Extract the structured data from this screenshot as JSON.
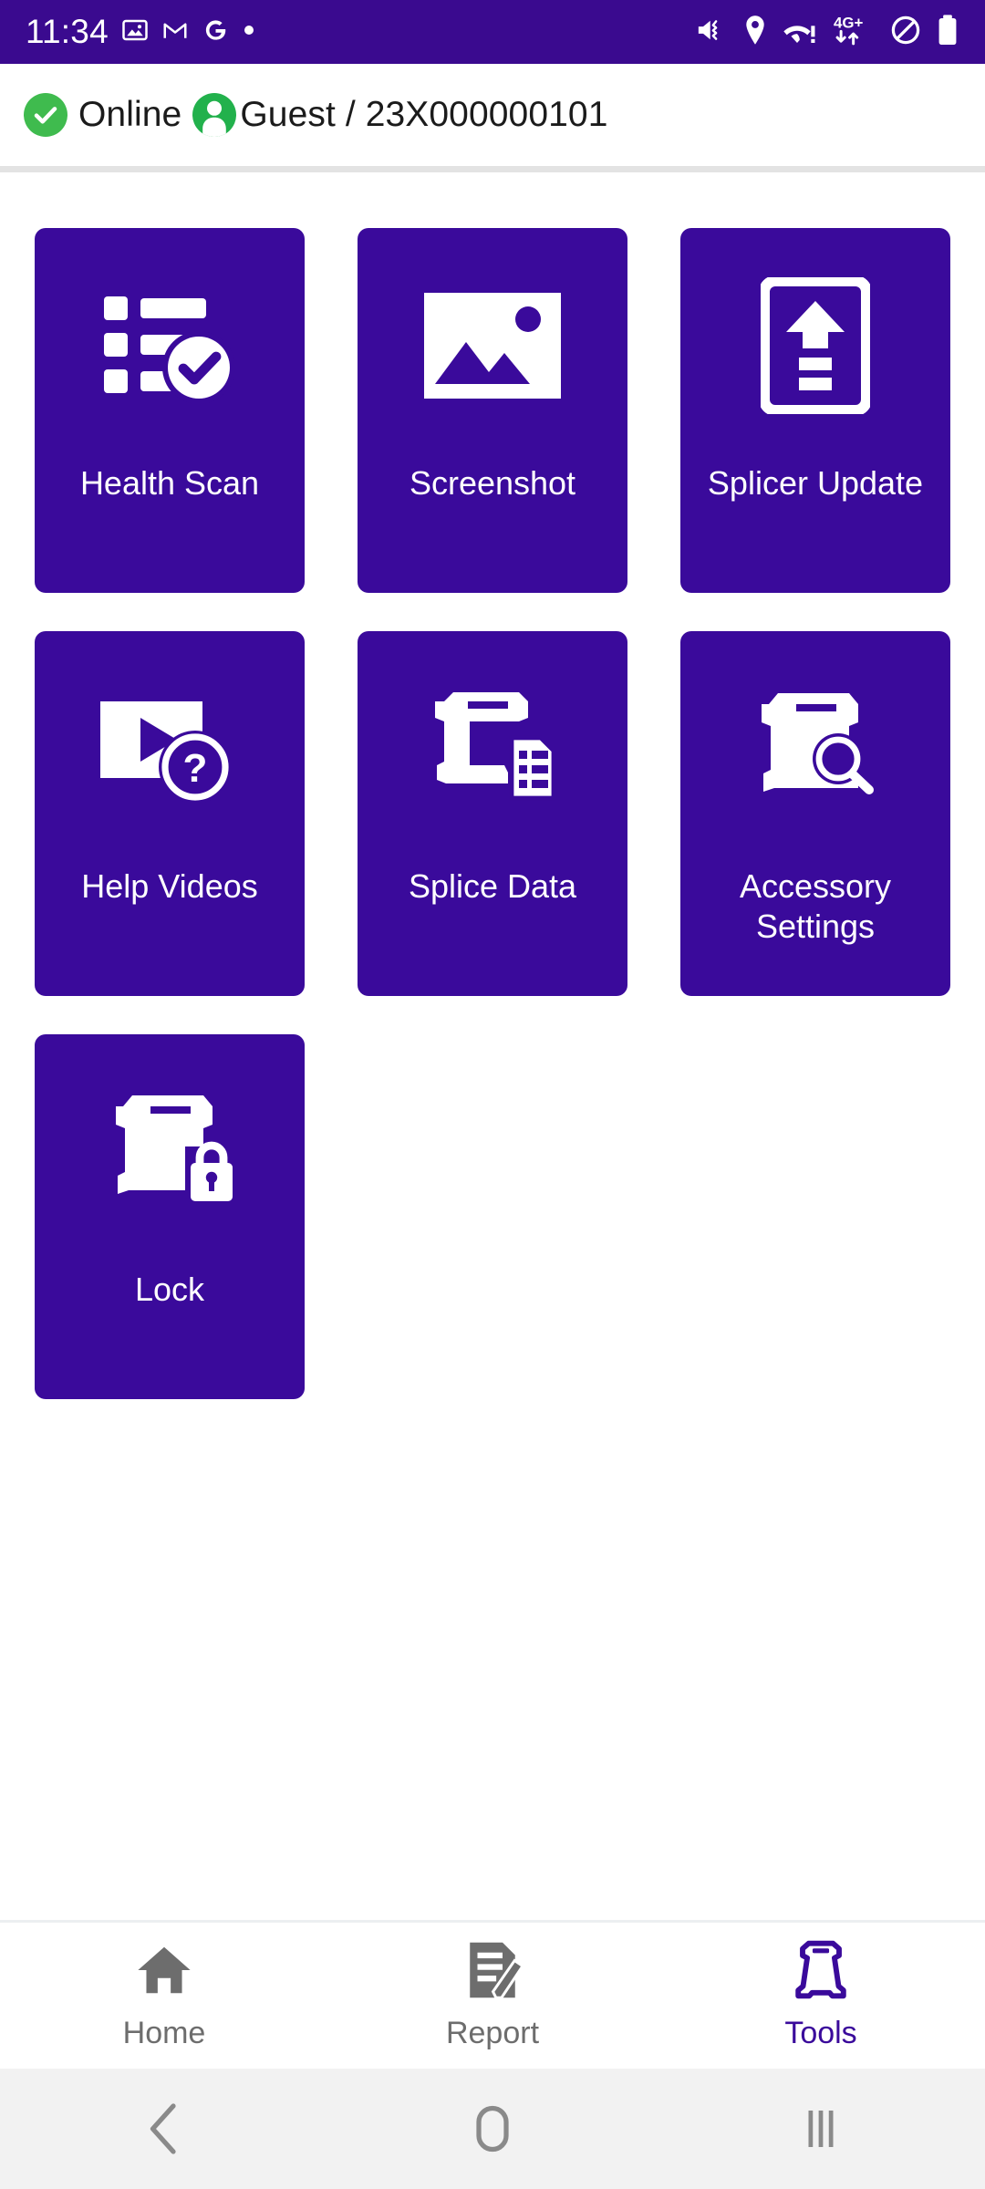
{
  "statusbar": {
    "time": "11:34",
    "left_icons": [
      "photos-icon",
      "gmail-icon",
      "google-icon",
      "dot-icon"
    ],
    "right_icons": [
      "mute-vibrate-icon",
      "location-icon",
      "wifi-warning-icon",
      "network-4g-plus-icon",
      "do-not-disturb-icon",
      "battery-icon"
    ],
    "network_label": "4G+",
    "background_color": "#3a0a8f"
  },
  "header": {
    "status_text": "Online",
    "account_text": "Guest / 23X000000101",
    "status_icon": "check-circle-icon",
    "account_icon": "person-icon",
    "status_color": "#3fbb4e"
  },
  "theme": {
    "tile_purple": "#3a0a9b",
    "accent": "#3a0a9b",
    "inactive_gray": "#6d6d6d"
  },
  "tiles": [
    {
      "label": "Health Scan",
      "icon": "checklist-check-icon"
    },
    {
      "label": "Screenshot",
      "icon": "image-photo-icon"
    },
    {
      "label": "Splicer Update",
      "icon": "document-upload-icon"
    },
    {
      "label": "Help Videos",
      "icon": "video-question-icon"
    },
    {
      "label": "Splice Data",
      "icon": "splicer-document-icon"
    },
    {
      "label": "Accessory Settings",
      "icon": "splicer-search-icon"
    },
    {
      "label": "Lock",
      "icon": "splicer-lock-icon"
    }
  ],
  "bottom_nav": {
    "items": [
      {
        "label": "Home",
        "icon": "home-icon",
        "active": false
      },
      {
        "label": "Report",
        "icon": "report-icon",
        "active": false
      },
      {
        "label": "Tools",
        "icon": "tools-icon",
        "active": true
      }
    ]
  },
  "system_nav": {
    "back": "back-icon",
    "home": "home-circle-icon",
    "recents": "recents-icon"
  }
}
